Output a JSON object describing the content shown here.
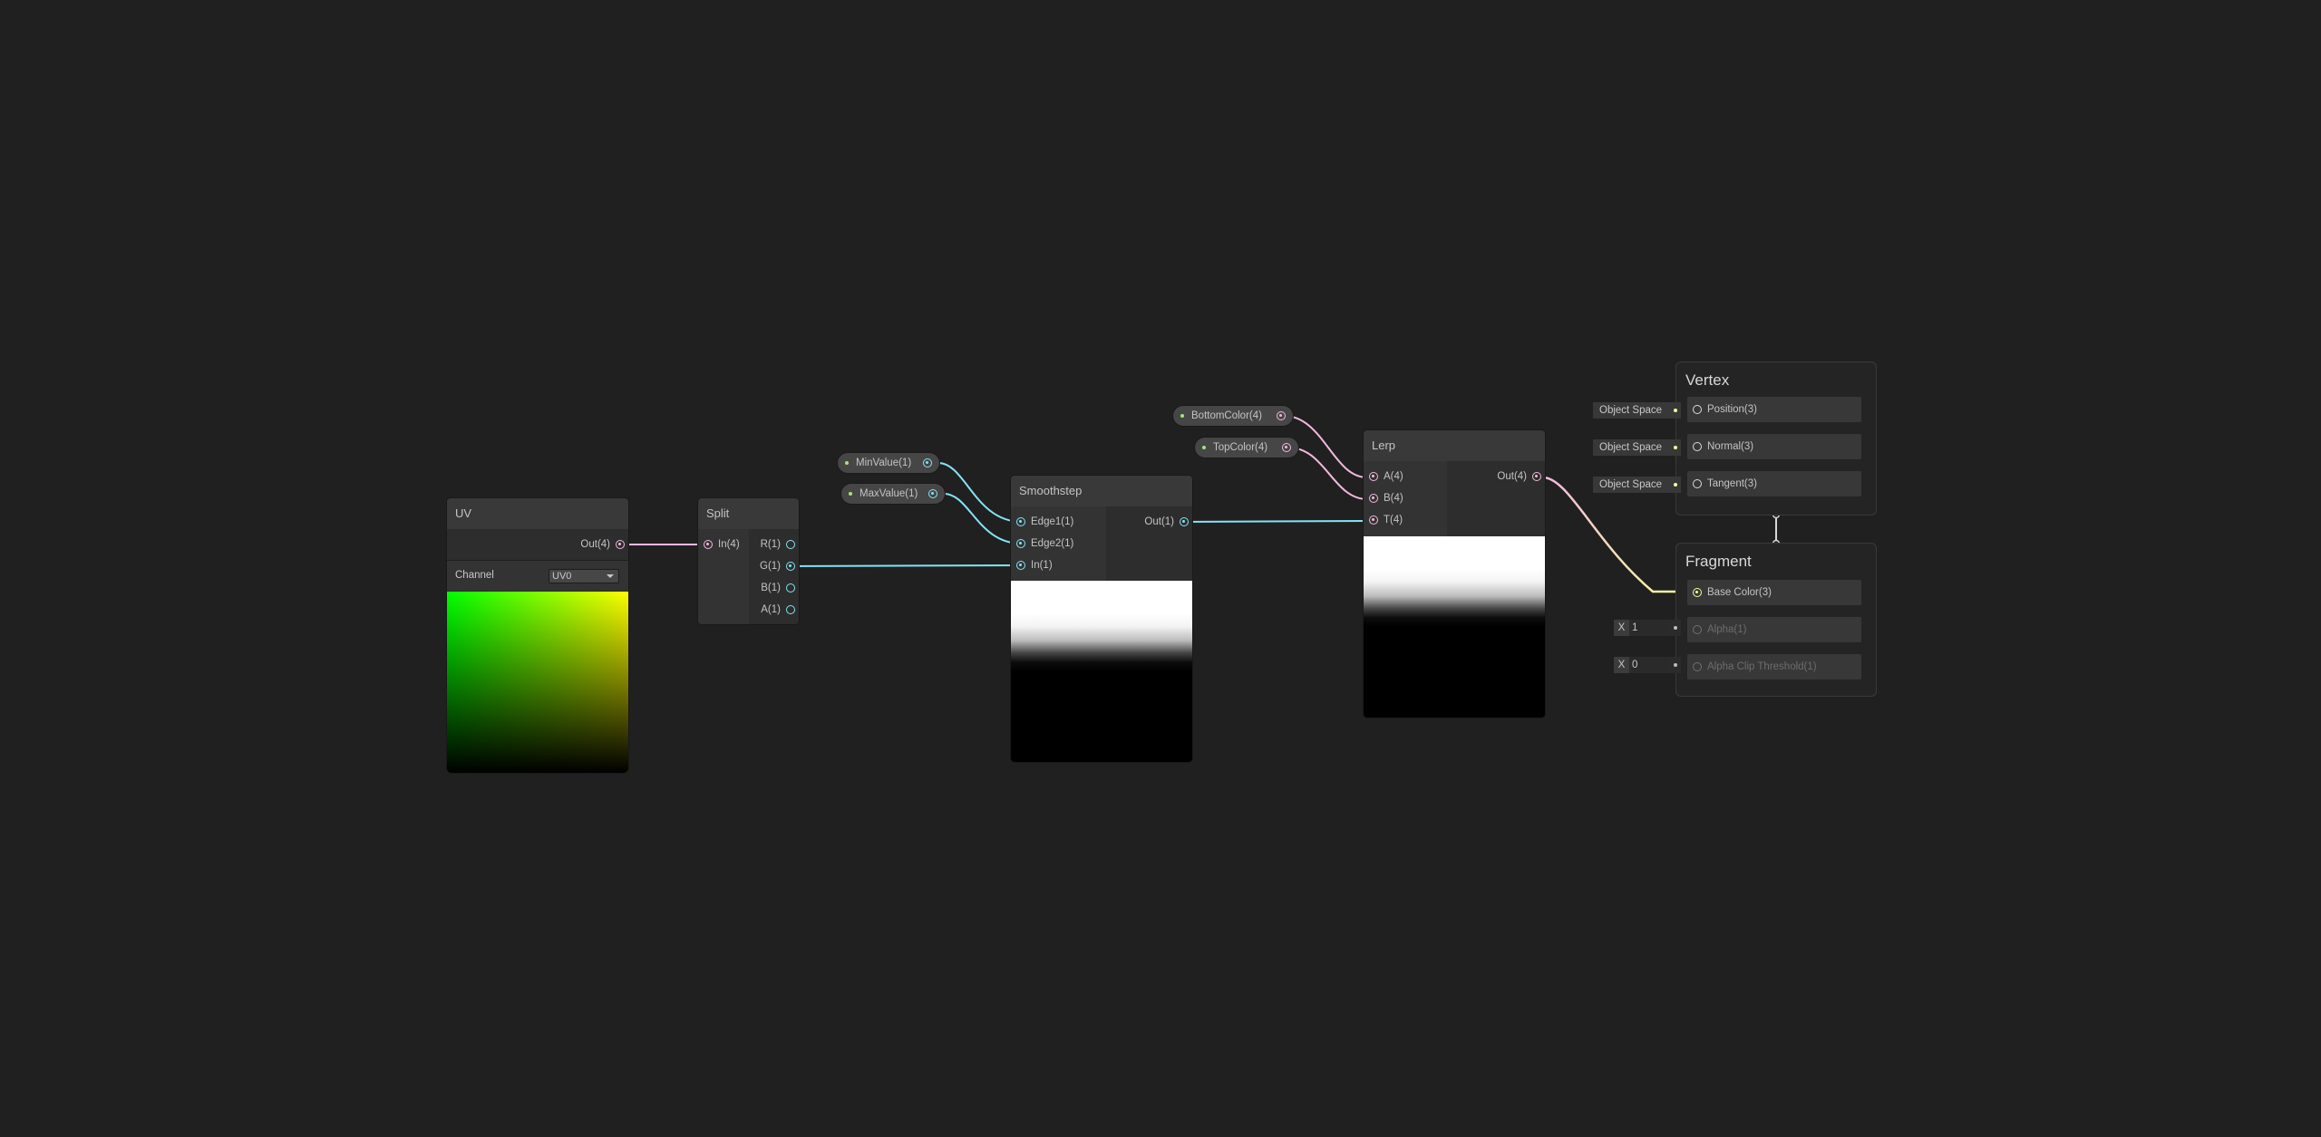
{
  "colors": {
    "background": "#202020",
    "vector4_wire": "#f3b9df",
    "float_wire": "#84e4f7",
    "vector3_wire": "#f6ff9a"
  },
  "nodes": {
    "uv": {
      "title": "UV",
      "out": "Out(4)",
      "channel_label": "Channel",
      "channel_value": "UV0",
      "dropdown_icon": "chevron-down-icon"
    },
    "split": {
      "title": "Split",
      "in": "In(4)",
      "outs": [
        "R(1)",
        "G(1)",
        "B(1)",
        "A(1)"
      ]
    },
    "smoothstep": {
      "title": "Smoothstep",
      "ins": [
        "Edge1(1)",
        "Edge2(1)",
        "In(1)"
      ],
      "out": "Out(1)"
    },
    "lerp": {
      "title": "Lerp",
      "ins": [
        "A(4)",
        "B(4)",
        "T(4)"
      ],
      "out": "Out(4)"
    }
  },
  "properties": {
    "min_value": "MinValue(1)",
    "max_value": "MaxValue(1)",
    "bottom_color": "BottomColor(4)",
    "top_color": "TopColor(4)"
  },
  "master": {
    "vertex": {
      "title": "Vertex",
      "slots": [
        "Position(3)",
        "Normal(3)",
        "Tangent(3)"
      ],
      "space_labels": [
        "Object Space",
        "Object Space",
        "Object Space"
      ]
    },
    "fragment": {
      "title": "Fragment",
      "slots": [
        "Base Color(3)",
        "Alpha(1)",
        "Alpha Clip Threshold(1)"
      ],
      "inputs": [
        {
          "axis": "X",
          "value": "1"
        },
        {
          "axis": "X",
          "value": "0"
        }
      ]
    }
  }
}
